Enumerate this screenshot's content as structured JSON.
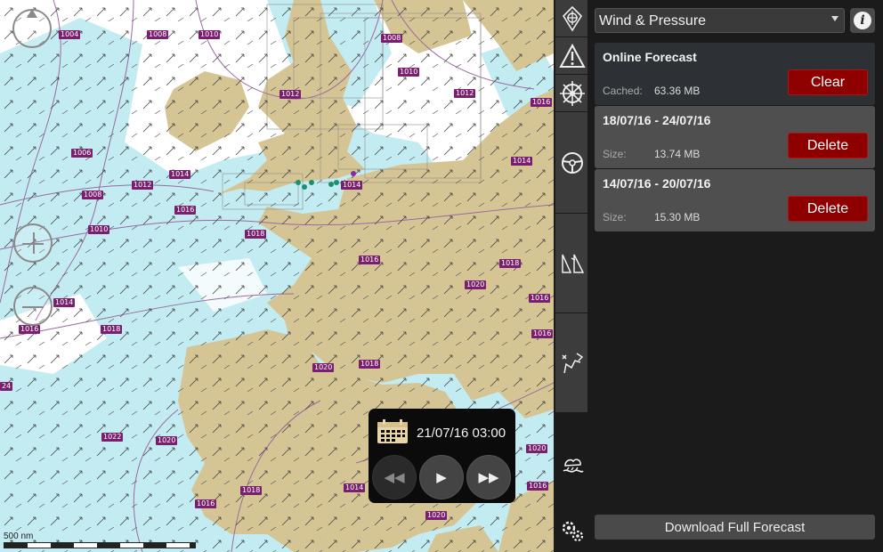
{
  "map": {
    "pressure_labels": [
      "1004",
      "1008",
      "1010",
      "1008",
      "1010",
      "1012",
      "1012",
      "1016",
      "1006",
      "1014",
      "1012",
      "1008",
      "1014",
      "1016",
      "1014",
      "1010",
      "1018",
      "1016",
      "1018",
      "1014",
      "1016",
      "1020",
      "1016",
      "1018",
      "1016",
      "1018",
      "1020",
      "1020",
      "1022",
      "1020",
      "1016",
      "1018",
      "1014",
      "1016",
      "1020",
      "24"
    ],
    "scale_label": "500 nm"
  },
  "player": {
    "datetime": "21/07/16 03:00"
  },
  "toolbar": {
    "items": [
      "compass-rose",
      "warning",
      "helm",
      "steering-wheel",
      "sails",
      "routing",
      "weather-station",
      "settings"
    ]
  },
  "panel": {
    "dropdown_value": "Wind & Pressure",
    "cards": [
      {
        "title": "Online Forecast",
        "label": "Cached:",
        "value": "63.36 MB",
        "button": "Clear"
      },
      {
        "title": "18/07/16 - 24/07/16",
        "label": "Size:",
        "value": "13.74 MB",
        "button": "Delete"
      },
      {
        "title": "14/07/16 - 20/07/16",
        "label": "Size:",
        "value": "15.30 MB",
        "button": "Delete"
      }
    ],
    "download_label": "Download Full Forecast"
  },
  "colors": {
    "land": "#d6c594",
    "shallow": "#c2ecf2",
    "sea": "#ffffff",
    "pressure_box": "#7a1f6e",
    "delete_red": "#8e0000"
  }
}
